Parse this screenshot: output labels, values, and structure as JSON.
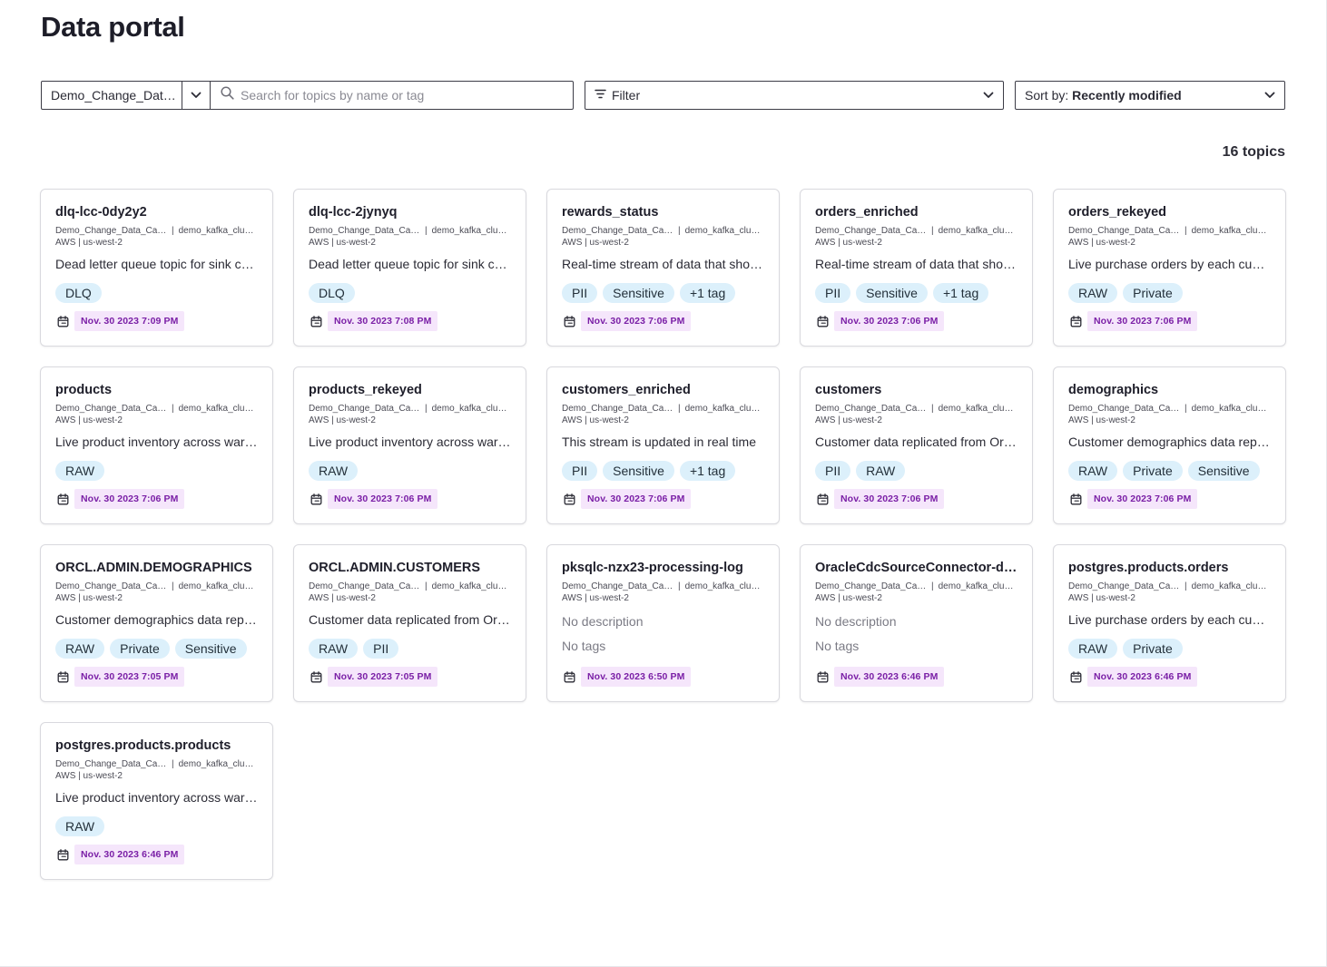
{
  "page": {
    "title": "Data portal"
  },
  "toolbar": {
    "environment_value": "Demo_Change_Data_Capture",
    "search_placeholder": "Search for topics by name or tag",
    "filter_label": "Filter",
    "sort_prefix": "Sort by:",
    "sort_value": "Recently modified"
  },
  "results": {
    "count_label": "16 topics"
  },
  "colors": {
    "tag_bg": "#dcf0fb",
    "date_bg": "#f5e6fb",
    "date_text": "#7a1fa6"
  },
  "cards": [
    {
      "name": "dlq-lcc-0dy2y2",
      "env": "Demo_Change_Data_Capture",
      "cluster": "demo_kafka_cluster",
      "region": "AWS | us-west-2",
      "description": "Dead letter queue topic for sink connector",
      "tags": [
        "DLQ"
      ],
      "date": "Nov. 30 2023 7:09 PM"
    },
    {
      "name": "dlq-lcc-2jynyq",
      "env": "Demo_Change_Data_Capture",
      "cluster": "demo_kafka_cluster",
      "region": "AWS | us-west-2",
      "description": "Dead letter queue topic for sink connector",
      "tags": [
        "DLQ"
      ],
      "date": "Nov. 30 2023 7:08 PM"
    },
    {
      "name": "rewards_status",
      "env": "Demo_Change_Data_Capture",
      "cluster": "demo_kafka_cluster",
      "region": "AWS | us-west-2",
      "description": "Real-time stream of data that shows rewards status",
      "tags": [
        "PII",
        "Sensitive",
        "+1 tag"
      ],
      "date": "Nov. 30 2023 7:06 PM"
    },
    {
      "name": "orders_enriched",
      "env": "Demo_Change_Data_Capture",
      "cluster": "demo_kafka_cluster",
      "region": "AWS | us-west-2",
      "description": "Real-time stream of data that shows enriched orders",
      "tags": [
        "PII",
        "Sensitive",
        "+1 tag"
      ],
      "date": "Nov. 30 2023 7:06 PM"
    },
    {
      "name": "orders_rekeyed",
      "env": "Demo_Change_Data_Capture",
      "cluster": "demo_kafka_cluster",
      "region": "AWS | us-west-2",
      "description": "Live purchase orders by each customer",
      "tags": [
        "RAW",
        "Private"
      ],
      "date": "Nov. 30 2023 7:06 PM"
    },
    {
      "name": "products",
      "env": "Demo_Change_Data_Capture",
      "cluster": "demo_kafka_cluster",
      "region": "AWS | us-west-2",
      "description": "Live product inventory across warehouses",
      "tags": [
        "RAW"
      ],
      "date": "Nov. 30 2023 7:06 PM"
    },
    {
      "name": "products_rekeyed",
      "env": "Demo_Change_Data_Capture",
      "cluster": "demo_kafka_cluster",
      "region": "AWS | us-west-2",
      "description": "Live product inventory across warehouses",
      "tags": [
        "RAW"
      ],
      "date": "Nov. 30 2023 7:06 PM"
    },
    {
      "name": "customers_enriched",
      "env": "Demo_Change_Data_Capture",
      "cluster": "demo_kafka_cluster",
      "region": "AWS | us-west-2",
      "description": "This stream is updated in real time",
      "tags": [
        "PII",
        "Sensitive",
        "+1 tag"
      ],
      "date": "Nov. 30 2023 7:06 PM"
    },
    {
      "name": "customers",
      "env": "Demo_Change_Data_Capture",
      "cluster": "demo_kafka_cluster",
      "region": "AWS | us-west-2",
      "description": "Customer data replicated from Oracle",
      "tags": [
        "PII",
        "RAW"
      ],
      "date": "Nov. 30 2023 7:06 PM"
    },
    {
      "name": "demographics",
      "env": "Demo_Change_Data_Capture",
      "cluster": "demo_kafka_cluster",
      "region": "AWS | us-west-2",
      "description": "Customer demographics data replicated",
      "tags": [
        "RAW",
        "Private",
        "Sensitive"
      ],
      "date": "Nov. 30 2023 7:06 PM"
    },
    {
      "name": "ORCL.ADMIN.DEMOGRAPHICS",
      "env": "Demo_Change_Data_Capture",
      "cluster": "demo_kafka_cluster",
      "region": "AWS | us-west-2",
      "description": "Customer demographics data replicated",
      "tags": [
        "RAW",
        "Private",
        "Sensitive"
      ],
      "date": "Nov. 30 2023 7:05 PM"
    },
    {
      "name": "ORCL.ADMIN.CUSTOMERS",
      "env": "Demo_Change_Data_Capture",
      "cluster": "demo_kafka_cluster",
      "region": "AWS | us-west-2",
      "description": "Customer data replicated from Oracle",
      "tags": [
        "RAW",
        "PII"
      ],
      "date": "Nov. 30 2023 7:05 PM"
    },
    {
      "name": "pksqlc-nzx23-processing-log",
      "env": "Demo_Change_Data_Capture",
      "cluster": "demo_kafka_cluster",
      "region": "AWS | us-west-2",
      "description": "No description",
      "no_tags": "No tags",
      "tags": [],
      "date": "Nov. 30 2023 6:50 PM"
    },
    {
      "name": "OracleCdcSourceConnector-demo",
      "env": "Demo_Change_Data_Capture",
      "cluster": "demo_kafka_cluster",
      "region": "AWS | us-west-2",
      "description": "No description",
      "no_tags": "No tags",
      "tags": [],
      "date": "Nov. 30 2023 6:46 PM"
    },
    {
      "name": "postgres.products.orders",
      "env": "Demo_Change_Data_Capture",
      "cluster": "demo_kafka_cluster",
      "region": "AWS | us-west-2",
      "description": "Live purchase orders by each customer",
      "tags": [
        "RAW",
        "Private"
      ],
      "date": "Nov. 30 2023 6:46 PM"
    },
    {
      "name": "postgres.products.products",
      "env": "Demo_Change_Data_Capture",
      "cluster": "demo_kafka_cluster",
      "region": "AWS | us-west-2",
      "description": "Live product inventory across warehouses",
      "tags": [
        "RAW"
      ],
      "date": "Nov. 30 2023 6:46 PM"
    }
  ]
}
